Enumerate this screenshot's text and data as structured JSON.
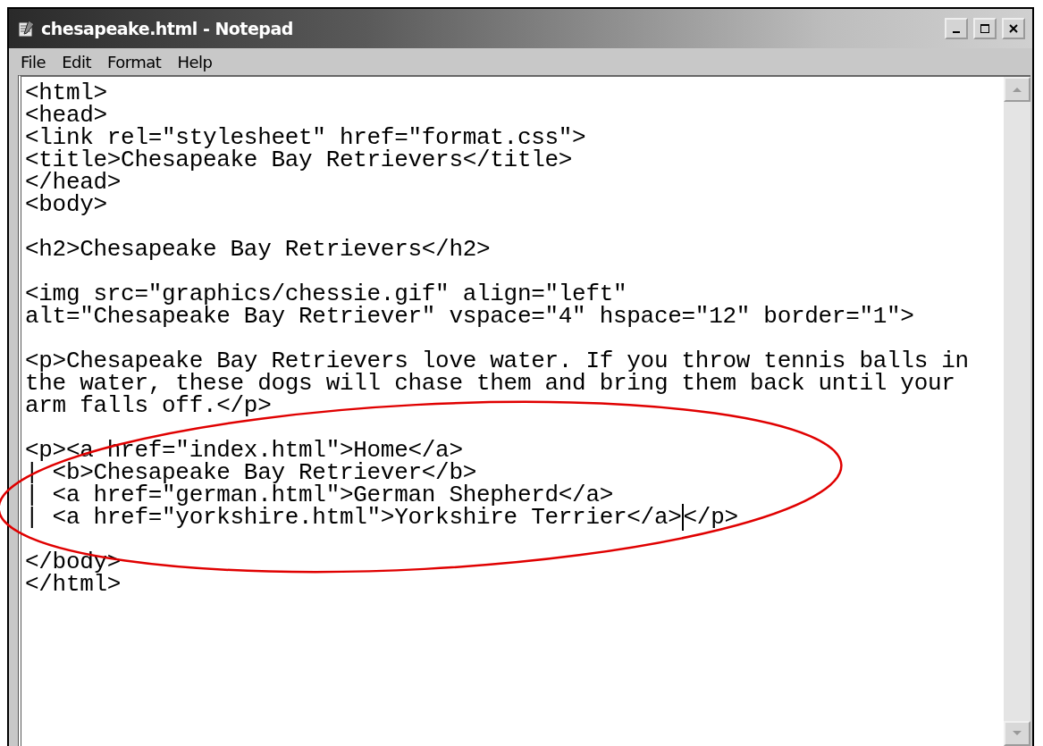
{
  "window": {
    "title": "chesapeake.html - Notepad"
  },
  "menu": [
    "File",
    "Edit",
    "Format",
    "Help"
  ],
  "editor": {
    "blocks": [
      {
        "lines": [
          {
            "text": "<html>"
          },
          {
            "text": "<head>"
          },
          {
            "text": "<link rel=\"stylesheet\" href=\"format.css\">"
          },
          {
            "text": "<title>Chesapeake Bay Retrievers</title>"
          },
          {
            "text": "</head>"
          },
          {
            "text": "<body>"
          }
        ]
      },
      {
        "lines": [
          {
            "text": "<h2>Chesapeake Bay Retrievers</h2>"
          }
        ]
      },
      {
        "lines": [
          {
            "text": "<img src=\"graphics/chessie.gif\" align=\"left\""
          },
          {
            "text": "alt=\"Chesapeake Bay Retriever\" vspace=\"4\" hspace=\"12\" border=\"1\">"
          }
        ]
      },
      {
        "lines": [
          {
            "text": "<p>Chesapeake Bay Retrievers love water. If you throw tennis balls in"
          },
          {
            "text": "the water, these dogs will chase them and bring them back until your"
          },
          {
            "text": "arm falls off.</p>"
          }
        ]
      },
      {
        "lines": [
          {
            "text": "<p><a href=\"index.html\">Home</a>"
          },
          {
            "text": "| <b>Chesapeake Bay Retriever</b>"
          },
          {
            "text": "| <a href=\"german.html\">German Shepherd</a>"
          },
          {
            "text": "| <a href=\"yorkshire.html\">Yorkshire Terrier</a>",
            "after_cursor": "</p>"
          }
        ]
      },
      {
        "lines": [
          {
            "text": "</body>"
          },
          {
            "text": "</html>"
          }
        ]
      }
    ]
  }
}
